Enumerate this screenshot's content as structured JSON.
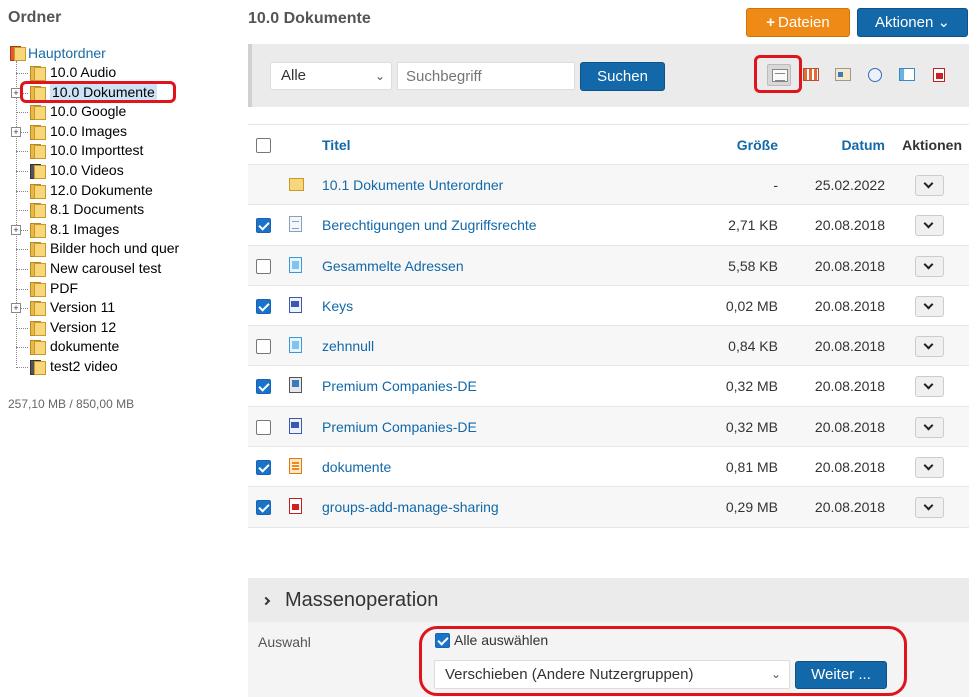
{
  "sidebar": {
    "title": "Ordner",
    "root": "Hauptordner",
    "folders": [
      {
        "label": "10.0 Audio",
        "expander": false,
        "type": "folder",
        "selected": false
      },
      {
        "label": "10.0 Dokumente",
        "expander": true,
        "type": "folder",
        "selected": true
      },
      {
        "label": "10.0 Google",
        "expander": false,
        "type": "folder",
        "selected": false
      },
      {
        "label": "10.0 Images",
        "expander": true,
        "type": "folder",
        "selected": false
      },
      {
        "label": "10.0 Importtest",
        "expander": false,
        "type": "folder",
        "selected": false
      },
      {
        "label": "10.0 Videos",
        "expander": false,
        "type": "video",
        "selected": false
      },
      {
        "label": "12.0 Dokumente",
        "expander": false,
        "type": "folder",
        "selected": false
      },
      {
        "label": "8.1 Documents",
        "expander": false,
        "type": "folder",
        "selected": false
      },
      {
        "label": "8.1 Images",
        "expander": true,
        "type": "folder",
        "selected": false
      },
      {
        "label": "Bilder hoch und quer",
        "expander": false,
        "type": "folder",
        "selected": false
      },
      {
        "label": "New carousel test",
        "expander": false,
        "type": "folder",
        "selected": false
      },
      {
        "label": "PDF",
        "expander": false,
        "type": "folder",
        "selected": false
      },
      {
        "label": "Version 11",
        "expander": true,
        "type": "folder",
        "selected": false
      },
      {
        "label": "Version 12",
        "expander": false,
        "type": "folder",
        "selected": false
      },
      {
        "label": "dokumente",
        "expander": false,
        "type": "folder",
        "selected": false
      },
      {
        "label": "test2 video",
        "expander": false,
        "type": "video",
        "selected": false
      }
    ],
    "quota": "257,10 MB / 850,00 MB"
  },
  "header": {
    "title": "10.0 Dokumente",
    "files_button": "Dateien",
    "actions_button": "Aktionen"
  },
  "toolbar": {
    "filter_value": "Alle",
    "search_placeholder": "Suchbegriff",
    "search_button": "Suchen",
    "view_icons": [
      "list-view-icon",
      "grid-view-icon",
      "card-view-icon",
      "timeline-view-icon",
      "panel-view-icon",
      "pdf-view-icon"
    ]
  },
  "table": {
    "headers": {
      "title": "Titel",
      "size": "Größe",
      "date": "Datum",
      "actions": "Aktionen"
    },
    "rows": [
      {
        "name": "10.1 Dokumente Unterordner",
        "size": "-",
        "date": "25.02.2022",
        "icon": "folder",
        "checked": null
      },
      {
        "name": "Berechtigungen und Zugriffsrechte",
        "size": "2,71 KB",
        "date": "20.08.2018",
        "icon": "doc",
        "checked": true
      },
      {
        "name": "Gesammelte Adressen",
        "size": "5,58 KB",
        "date": "20.08.2018",
        "icon": "sheet",
        "checked": false
      },
      {
        "name": "Keys",
        "size": "0,02 MB",
        "date": "20.08.2018",
        "icon": "word",
        "checked": true
      },
      {
        "name": "zehnnull",
        "size": "0,84 KB",
        "date": "20.08.2018",
        "icon": "sheet",
        "checked": false
      },
      {
        "name": "Premium Companies-DE",
        "size": "0,32 MB",
        "date": "20.08.2018",
        "icon": "db",
        "checked": true
      },
      {
        "name": "Premium Companies-DE",
        "size": "0,32 MB",
        "date": "20.08.2018",
        "icon": "word",
        "checked": false
      },
      {
        "name": "dokumente",
        "size": "0,81 MB",
        "date": "20.08.2018",
        "icon": "zip",
        "checked": true
      },
      {
        "name": "groups-add-manage-sharing",
        "size": "0,29 MB",
        "date": "20.08.2018",
        "icon": "pdf",
        "checked": true
      }
    ]
  },
  "mass": {
    "title": "Massenoperation",
    "selection_label": "Auswahl",
    "select_all_label": "Alle auswählen",
    "operation_value": "Verschieben (Andere Nutzergruppen)",
    "go_button": "Weiter ..."
  },
  "colors": {
    "accent": "#1268a8",
    "orange": "#f08a17",
    "highlight": "#e0141c"
  }
}
